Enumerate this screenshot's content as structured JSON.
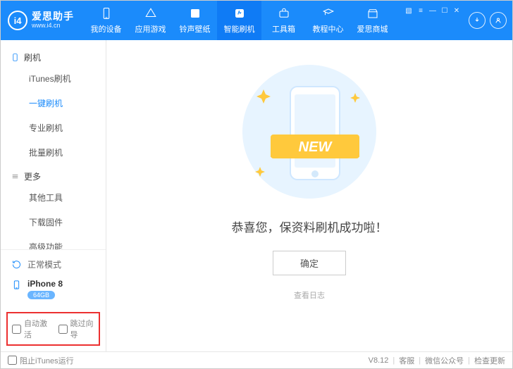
{
  "header": {
    "logo_title": "爱思助手",
    "logo_sub": "www.i4.cn",
    "nav": [
      {
        "label": "我的设备"
      },
      {
        "label": "应用游戏"
      },
      {
        "label": "铃声壁纸"
      },
      {
        "label": "智能刷机",
        "active": true
      },
      {
        "label": "工具箱"
      },
      {
        "label": "教程中心"
      },
      {
        "label": "爱思商城"
      }
    ]
  },
  "sidebar": {
    "group1_title": "刷机",
    "items1": [
      {
        "label": "iTunes刷机"
      },
      {
        "label": "一键刷机",
        "active": true
      },
      {
        "label": "专业刷机"
      },
      {
        "label": "批量刷机"
      }
    ],
    "group2_title": "更多",
    "items2": [
      {
        "label": "其他工具"
      },
      {
        "label": "下载固件"
      },
      {
        "label": "高级功能"
      }
    ],
    "mode_label": "正常模式",
    "device_name": "iPhone 8",
    "device_badge": "64GB",
    "auto_activate_label": "自动激活",
    "skip_wizard_label": "跳过向导"
  },
  "main": {
    "success_text": "恭喜您，保资料刷机成功啦！",
    "ok_button": "确定",
    "view_log": "查看日志"
  },
  "footer": {
    "block_itunes": "阻止iTunes运行",
    "version": "V8.12",
    "support": "客服",
    "wechat": "微信公众号",
    "check_update": "检查更新"
  }
}
